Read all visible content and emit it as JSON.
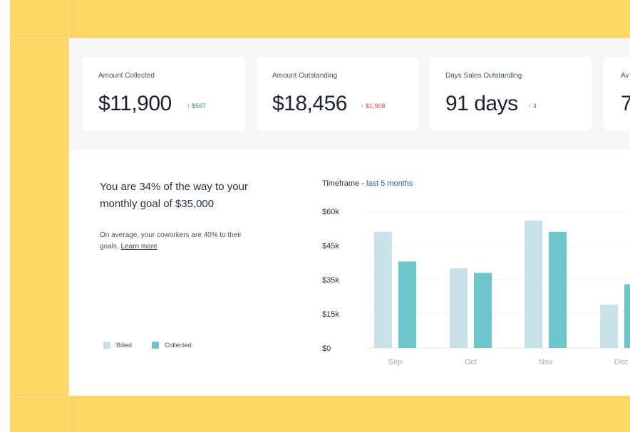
{
  "stats": [
    {
      "label": "Amount Collected",
      "value": "$11,900",
      "delta": "↑ $567",
      "trend": "good"
    },
    {
      "label": "Amount Outstanding",
      "value": "$18,456",
      "delta": "↑ $1,908",
      "trend": "bad"
    },
    {
      "label": "Days Sales Outstanding",
      "value": "91 days",
      "delta": "↑ 4",
      "trend": "bad"
    },
    {
      "label": "Av",
      "value": "7"
    }
  ],
  "goal": {
    "headline": "You are 34% of the way to your monthly goal of $35,000",
    "coworkers_text": "On average, your coworkers are 40% to their goals.",
    "learn_more": "Learn more"
  },
  "timeframe": {
    "label": "Timeframe -",
    "value": "last 5 months"
  },
  "legend": [
    {
      "label": "Billed",
      "color": "#c9e2e8"
    },
    {
      "label": "Collected",
      "color": "#6cc6cc"
    }
  ],
  "colors": {
    "accent_yellow": "#fdd663",
    "billed": "#c9e2e8",
    "collected": "#6cc6cc",
    "link_blue": "#1f5bd6"
  },
  "chart_data": {
    "type": "bar",
    "categories": [
      "Sep",
      "Oct",
      "Nov",
      "Dec"
    ],
    "y_tick_labels": [
      "$60k",
      "$45k",
      "$35k",
      "$15k",
      "$0"
    ],
    "series": [
      {
        "name": "Billed",
        "values": [
          51,
          35,
          56,
          19
        ]
      },
      {
        "name": "Collected",
        "values": [
          38,
          33,
          51,
          28
        ]
      }
    ],
    "value_units": "thousands of dollars (estimated)",
    "grid": true
  }
}
